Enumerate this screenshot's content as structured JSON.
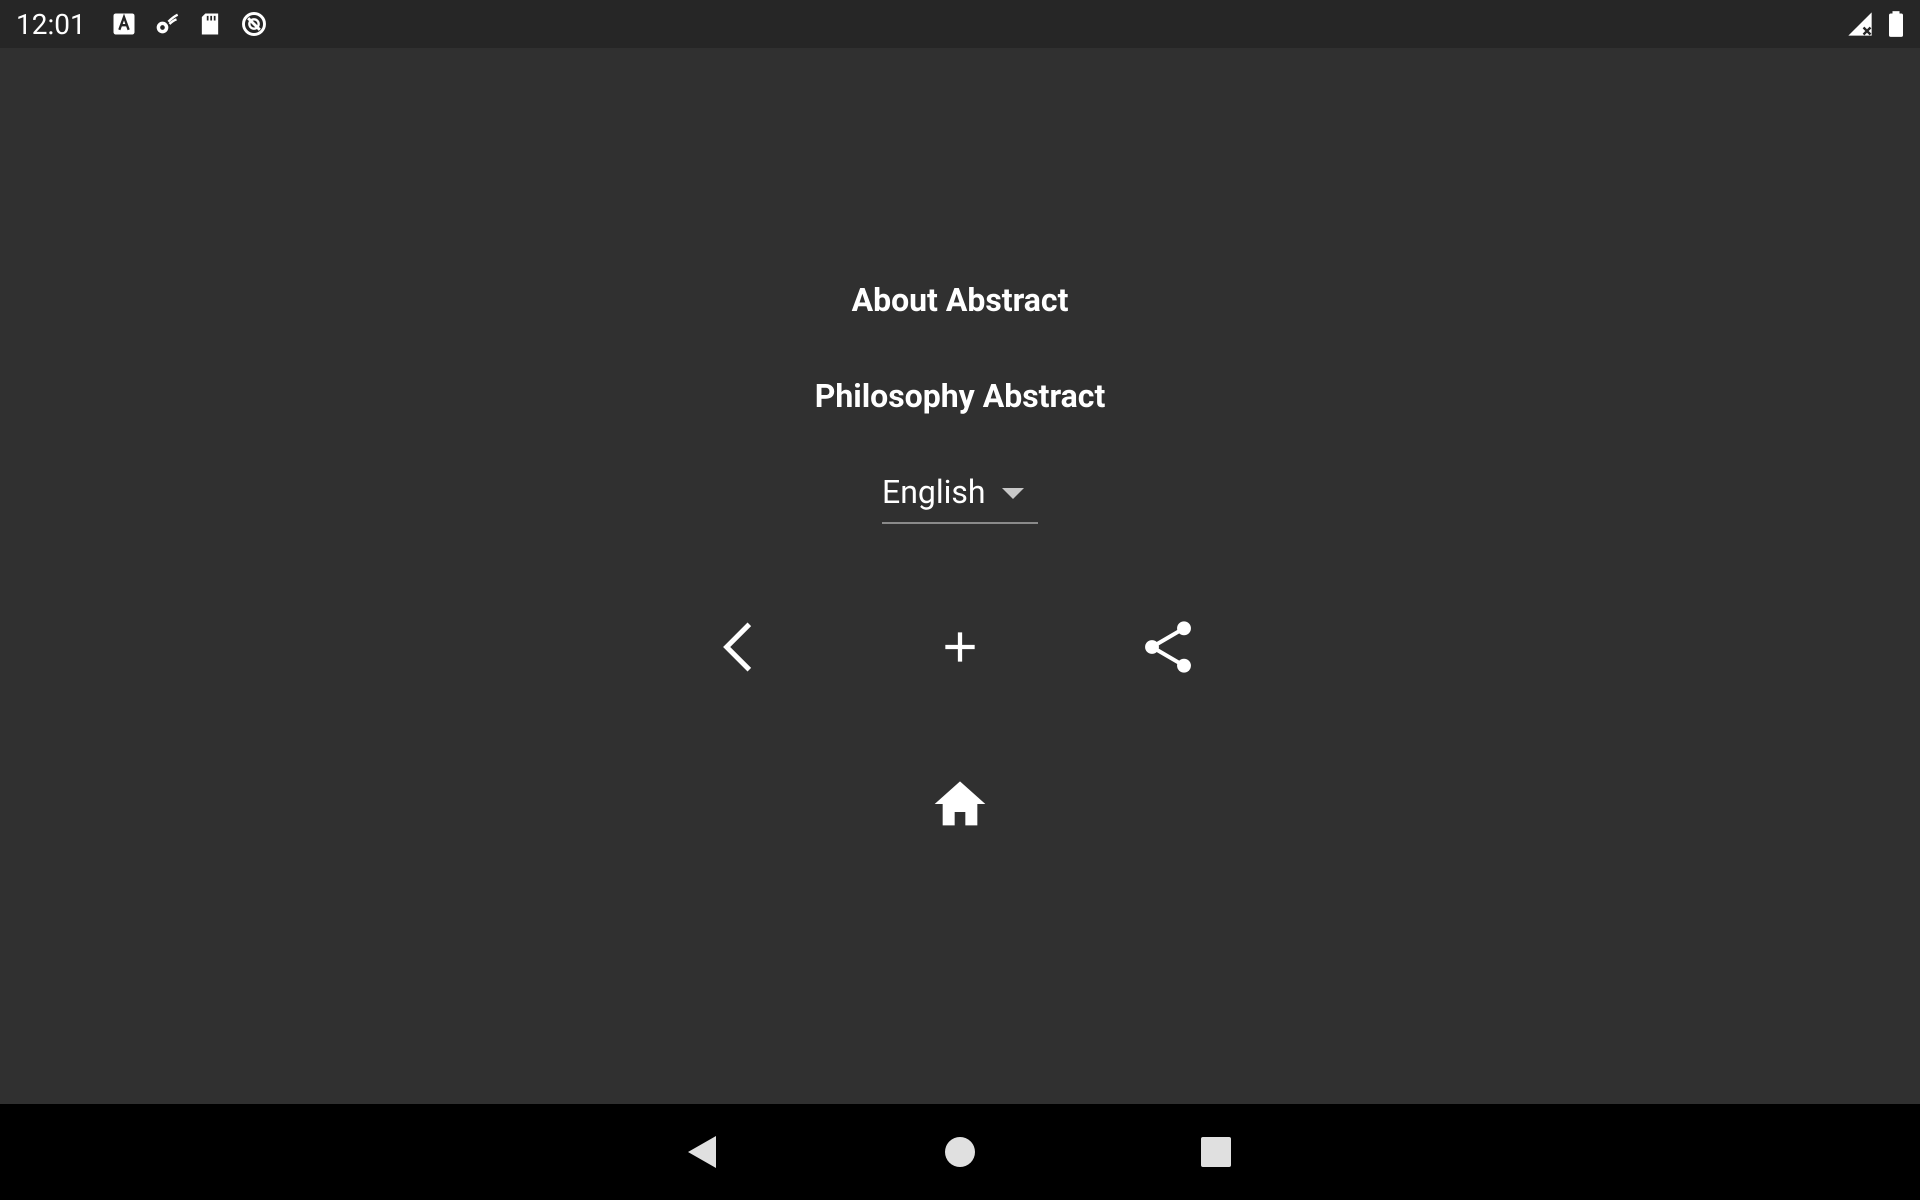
{
  "status_bar": {
    "time": "12:01",
    "left_icons": [
      "font-a-icon",
      "settings-gear-icon",
      "sd-card-icon",
      "sync-disabled-icon"
    ],
    "right_icons": [
      "signal-off-icon",
      "battery-icon"
    ]
  },
  "main": {
    "about_title": "About Abstract",
    "philosophy_title": "Philosophy Abstract",
    "language_selected": "English",
    "action_icons": [
      "back-chevron-icon",
      "add-icon",
      "share-icon"
    ],
    "home_icon": "home-icon"
  },
  "nav_bar": {
    "buttons": [
      "nav-back-icon",
      "nav-home-icon",
      "nav-recents-icon"
    ]
  },
  "colors": {
    "background": "#303030",
    "status_bar": "#262626",
    "nav_bar": "#000000",
    "text": "#ffffff",
    "underline": "#8a8a8a"
  }
}
